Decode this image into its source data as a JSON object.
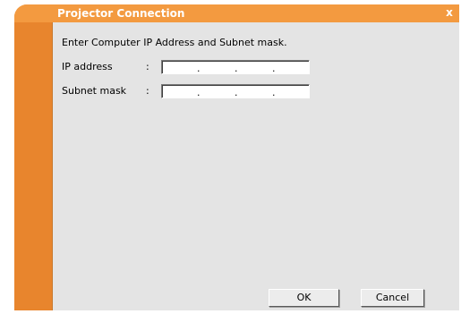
{
  "window": {
    "title": "Projector Connection",
    "close_glyph": "x",
    "close_icon": "close-icon"
  },
  "form": {
    "instruction": "Enter Computer IP Address and Subnet mask.",
    "ip_label": "IP address",
    "subnet_label": "Subnet mask",
    "separator": ":",
    "ip_dots": [
      ".",
      ".",
      "."
    ],
    "subnet_dots": [
      ".",
      ".",
      "."
    ]
  },
  "buttons": {
    "ok_label": "OK",
    "cancel_label": "Cancel"
  },
  "colors": {
    "accent_orange": "#f39a40",
    "sidebar_orange": "#e8852d",
    "panel_gray": "#e4e4e4"
  }
}
